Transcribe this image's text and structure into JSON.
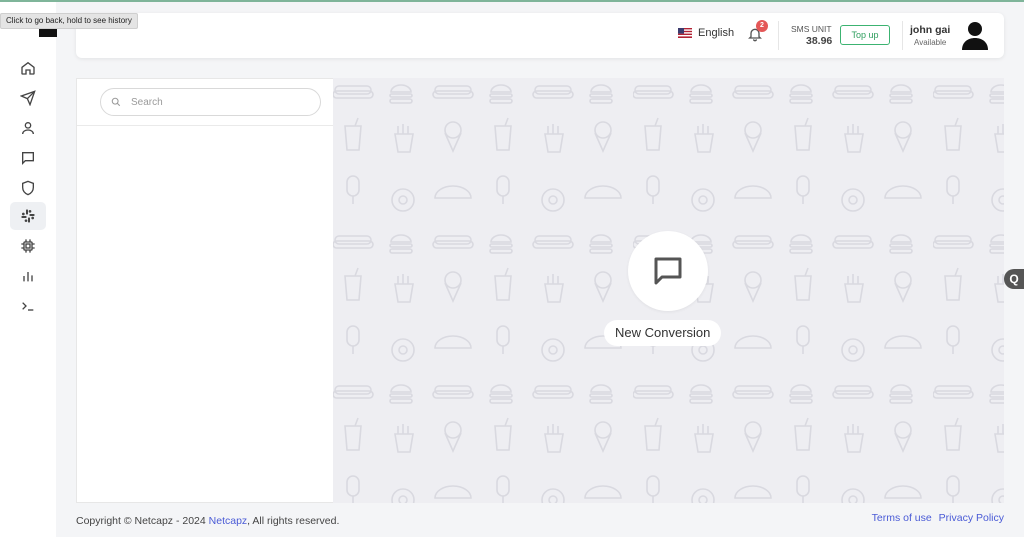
{
  "browser": {
    "back_tooltip": "Click to go back, hold to see history"
  },
  "sidebar": {
    "items": [
      {
        "name": "home",
        "icon": "home-icon"
      },
      {
        "name": "send",
        "icon": "send-icon"
      },
      {
        "name": "contacts",
        "icon": "user-icon"
      },
      {
        "name": "messages",
        "icon": "chat-icon"
      },
      {
        "name": "security",
        "icon": "shield-icon"
      },
      {
        "name": "integrations",
        "icon": "slack-icon",
        "active": true
      },
      {
        "name": "chip",
        "icon": "chip-icon"
      },
      {
        "name": "reports",
        "icon": "bar-chart-icon"
      },
      {
        "name": "console",
        "icon": "terminal-icon"
      }
    ]
  },
  "header": {
    "language": "English",
    "notification_count": "2",
    "sms_unit_label": "SMS UNIT",
    "sms_unit_value": "38.96",
    "topup_label": "Top up",
    "user_name": "john gai",
    "user_status": "Available"
  },
  "chat_list": {
    "search_placeholder": "Search"
  },
  "chat_area": {
    "new_conversation_label": "New Conversion"
  },
  "footer": {
    "copyright": "Copyright © Netcapz - 2024",
    "brand_link": "Netcapz",
    "rights": ", All rights reserved.",
    "terms": "Terms of use",
    "privacy": "Privacy Policy"
  },
  "colors": {
    "accent": "#4a5bd6",
    "topup": "#3cb371",
    "badge": "#e45757"
  },
  "edge_tab_icon": "q-icon"
}
